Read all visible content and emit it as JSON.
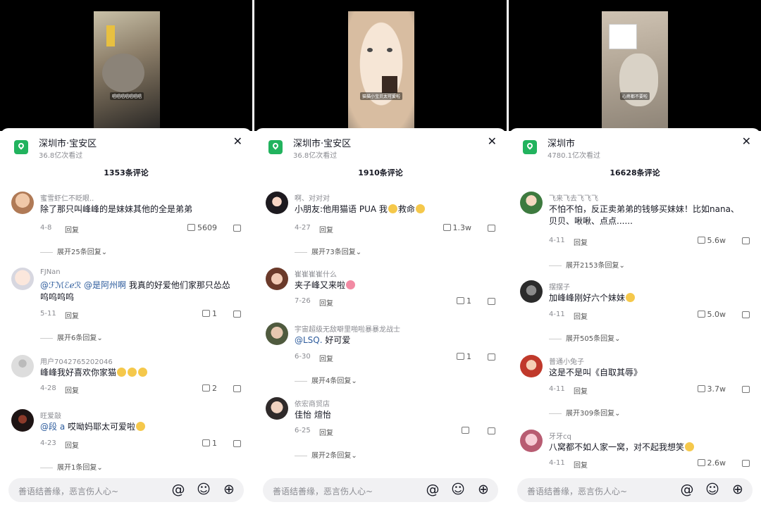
{
  "panels": [
    {
      "video": {
        "caption": "唱唱唱唱唱唱唱"
      },
      "location": {
        "title": "深圳市·宝安区",
        "views": "36.8亿次看过"
      },
      "close": "✕",
      "comment_count": "1353条评论",
      "comments": [
        {
          "user": "蜜雪虾仁不眨眼..",
          "text": "除了那只叫峰峰的是妹妹其他的全是弟弟",
          "date": "4-8",
          "reply": "回复",
          "likes": "5609",
          "expand": "展开25条回复⌄"
        },
        {
          "user": "FJNan",
          "mention": "@ℱℳℰℯℛ @是阿州啊",
          "text": " 我真的好爱他们家那只怂怂呜呜呜呜",
          "date": "5-11",
          "reply": "回复",
          "likes": "1",
          "expand": "展开6条回复⌄"
        },
        {
          "user": "用户7042765202046",
          "text": "峰峰我好喜欢你家猫",
          "date": "4-28",
          "reply": "回复",
          "likes": "2"
        },
        {
          "user": "旺爱敲",
          "mention": "@段 a",
          "text": " 哎呦妈耶太可爱啦",
          "date": "4-23",
          "reply": "回复",
          "likes": "1",
          "expand": "展开1条回复⌄"
        }
      ]
    },
    {
      "video": {
        "caption": "猫猫小宝贝太可爱啦"
      },
      "location": {
        "title": "深圳市·宝安区",
        "views": "36.8亿次看过"
      },
      "close": "✕",
      "comment_count": "1910条评论",
      "comments": [
        {
          "user": "啊、对对对",
          "text": "小朋友:他用猫语 PUA 我",
          "text2": "救命",
          "date": "4-27",
          "reply": "回复",
          "likes": "1.3w",
          "expand": "展开73条回复⌄"
        },
        {
          "user": "崔崔崔崔什么",
          "text": "夹子峰又来啦",
          "date": "7-26",
          "reply": "回复",
          "likes": "1"
        },
        {
          "user": "宇宙超级无敌噼里啪啦暴暴龙战士",
          "mention": "@LSQ.",
          "text": " 好可爱",
          "date": "6-30",
          "reply": "回复",
          "likes": "1",
          "expand": "展开4条回复⌄"
        },
        {
          "user": "依宏商贸店",
          "text": "佳怡   煊怡",
          "date": "6-25",
          "reply": "回复",
          "likes": "",
          "expand": "展开2条回复⌄"
        }
      ]
    },
    {
      "video": {
        "caption": "心疼都不要啦"
      },
      "location": {
        "title": "深圳市",
        "views": "4780.1亿次看过"
      },
      "close": "✕",
      "comment_count": "16628条评论",
      "comments": [
        {
          "user": "飞来飞去飞飞飞",
          "text": "不怕不怕，反正卖弟弟的钱够买妹妹！比如nana、贝贝、啾啾、点点......",
          "date": "4-11",
          "reply": "回复",
          "likes": "5.6w",
          "expand": "展开2153条回复⌄"
        },
        {
          "user": "摆摆子",
          "text": "加峰峰刚好六个妹妹",
          "date": "4-11",
          "reply": "回复",
          "likes": "5.0w",
          "expand": "展开505条回复⌄"
        },
        {
          "user": "普通小兔子",
          "text": "这是不是叫《自取其辱》",
          "date": "4-11",
          "reply": "回复",
          "likes": "3.7w",
          "expand": "展开309条回复⌄"
        },
        {
          "user": "牙牙cq",
          "text": "八窝都不如人家一窝，对不起我想笑",
          "date": "4-11",
          "reply": "回复",
          "likes": "2.6w"
        }
      ]
    }
  ],
  "input": {
    "placeholder": "善语结善缘，恶言伤人心~",
    "at": "@",
    "emoji": "☺",
    "plus": "⊕"
  },
  "colors": {
    "location_icon": "#22b35e",
    "mention": "#2c5b9c",
    "muted": "#8a8b91"
  }
}
